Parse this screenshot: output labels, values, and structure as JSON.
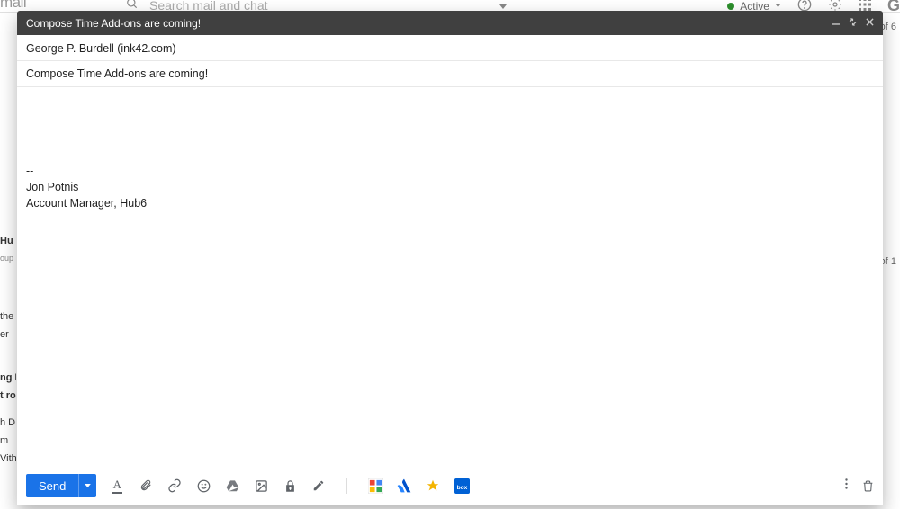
{
  "backdrop": {
    "logo": "mail",
    "search_placeholder": "Search mail and chat",
    "active_label": "Active",
    "pagination1": "of 6",
    "pagination2": "of 1",
    "side_items": [
      "",
      "",
      "",
      "",
      "",
      "",
      "",
      "",
      "",
      "",
      "Hu",
      "oup",
      "",
      "",
      "",
      "the H",
      "er",
      "",
      "",
      "ng P",
      "t ro",
      "h D",
      "m",
      "Vith"
    ]
  },
  "compose": {
    "title": "Compose Time Add-ons are coming!",
    "to": "George P. Burdell (ink42.com)",
    "subject": "Compose Time Add-ons are coming!",
    "signature_dashes": "--",
    "signature_name": "Jon Potnis",
    "signature_title": "Account Manager, Hub6",
    "send_label": "Send"
  }
}
